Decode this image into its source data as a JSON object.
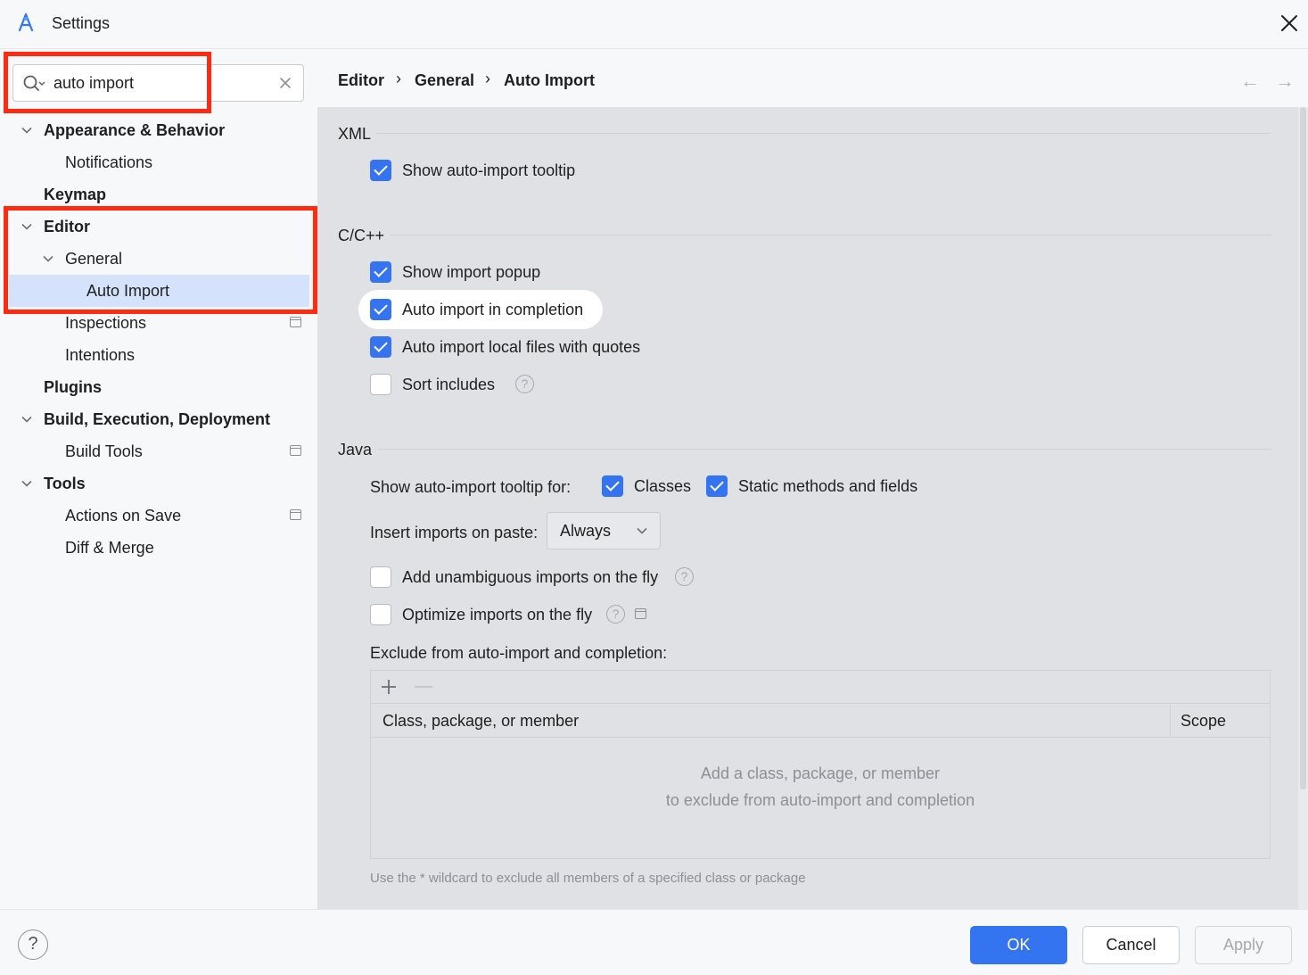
{
  "window": {
    "title": "Settings"
  },
  "search": {
    "value": "auto import",
    "placeholder": ""
  },
  "sidebar": {
    "items": [
      {
        "label": "Appearance & Behavior",
        "expanded": true,
        "bold": true
      },
      {
        "label": "Notifications"
      },
      {
        "label": "Keymap",
        "bold": true
      },
      {
        "label": "Editor",
        "expanded": true,
        "bold": true
      },
      {
        "label": "General",
        "expanded": true
      },
      {
        "label": "Auto Import",
        "selected": true
      },
      {
        "label": "Inspections",
        "badge": true
      },
      {
        "label": "Intentions"
      },
      {
        "label": "Plugins",
        "bold": true
      },
      {
        "label": "Build, Execution, Deployment",
        "expanded": true,
        "bold": true
      },
      {
        "label": "Build Tools",
        "badge": true
      },
      {
        "label": "Tools",
        "expanded": true,
        "bold": true
      },
      {
        "label": "Actions on Save",
        "badge": true
      },
      {
        "label": "Diff & Merge"
      }
    ]
  },
  "breadcrumb": {
    "items": [
      "Editor",
      "General",
      "Auto Import"
    ],
    "separator": "›",
    "back": "←",
    "forward": "→"
  },
  "sections": {
    "xml": {
      "title": "XML",
      "show_tooltip": {
        "label": "Show auto-import tooltip",
        "checked": true
      }
    },
    "cpp": {
      "title": "C/C++",
      "show_popup": {
        "label": "Show import popup",
        "checked": true
      },
      "auto_import_completion": {
        "label": "Auto import in completion",
        "checked": true
      },
      "auto_import_local": {
        "label": "Auto import local files with quotes",
        "checked": true
      },
      "sort_includes": {
        "label": "Sort includes",
        "checked": false
      }
    },
    "java": {
      "title": "Java",
      "tooltip_for_label": "Show auto-import tooltip for:",
      "classes": {
        "label": "Classes",
        "checked": true
      },
      "static_methods": {
        "label": "Static methods and fields",
        "checked": true
      },
      "insert_on_paste_label": "Insert imports on paste:",
      "insert_on_paste_value": "Always",
      "add_unambiguous": {
        "label": "Add unambiguous imports on the fly",
        "checked": false
      },
      "optimize_imports": {
        "label": "Optimize imports on the fly",
        "checked": false
      },
      "exclude_label": "Exclude from auto-import and completion:",
      "table": {
        "columns": [
          "Class, package, or member",
          "Scope"
        ],
        "rows": [],
        "empty_line1": "Add a class, package, or member",
        "empty_line2": "to exclude from auto-import and completion"
      },
      "hint": "Use the * wildcard to exclude all members of a specified class or package"
    }
  },
  "footer": {
    "help": "?",
    "ok": "OK",
    "cancel": "Cancel",
    "apply": "Apply"
  },
  "colors": {
    "accent": "#3574f0",
    "highlight_box": "#ff2a12",
    "selection": "#d4e2fb"
  }
}
